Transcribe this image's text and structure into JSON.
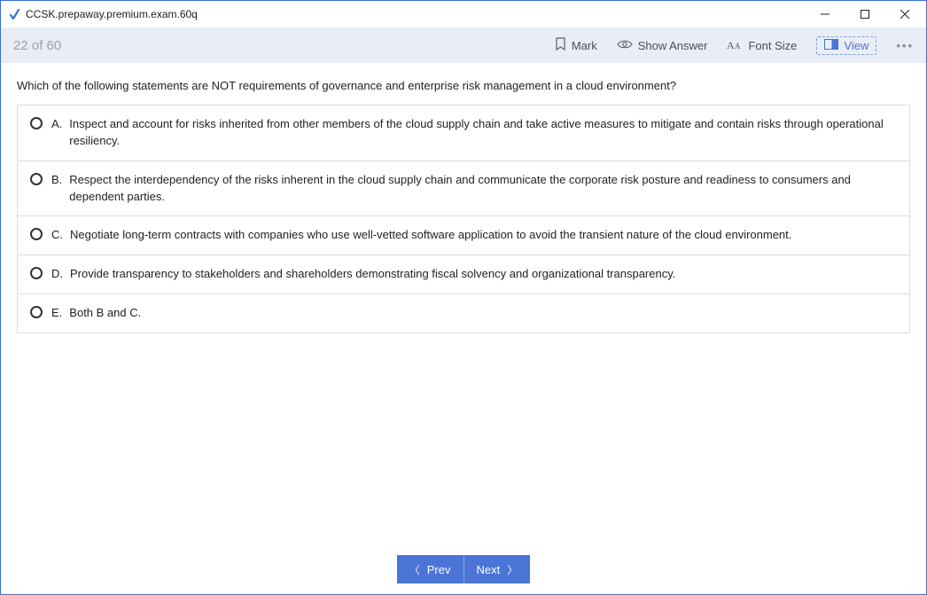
{
  "window": {
    "title": "CCSK.prepaway.premium.exam.60q"
  },
  "toolbar": {
    "counter": "22 of 60",
    "mark": "Mark",
    "show_answer": "Show Answer",
    "font_size": "Font Size",
    "view": "View"
  },
  "question": {
    "text": "Which of the following statements are NOT requirements of governance and enterprise risk management in a cloud environment?",
    "options": [
      {
        "letter": "A.",
        "text": "Inspect and account for risks inherited from other members of the cloud supply chain and take active measures to mitigate and contain risks through operational resiliency."
      },
      {
        "letter": "B.",
        "text": "Respect the interdependency of the risks inherent in the cloud supply chain and communicate the corporate risk posture and readiness to consumers and dependent parties."
      },
      {
        "letter": "C.",
        "text": "Negotiate long-term contracts with companies who use well-vetted software application to avoid the transient nature of the cloud environment."
      },
      {
        "letter": "D.",
        "text": "Provide transparency to stakeholders and shareholders demonstrating fiscal solvency and organizational transparency."
      },
      {
        "letter": "E.",
        "text": "Both B and C."
      }
    ]
  },
  "nav": {
    "prev": "Prev",
    "next": "Next"
  }
}
